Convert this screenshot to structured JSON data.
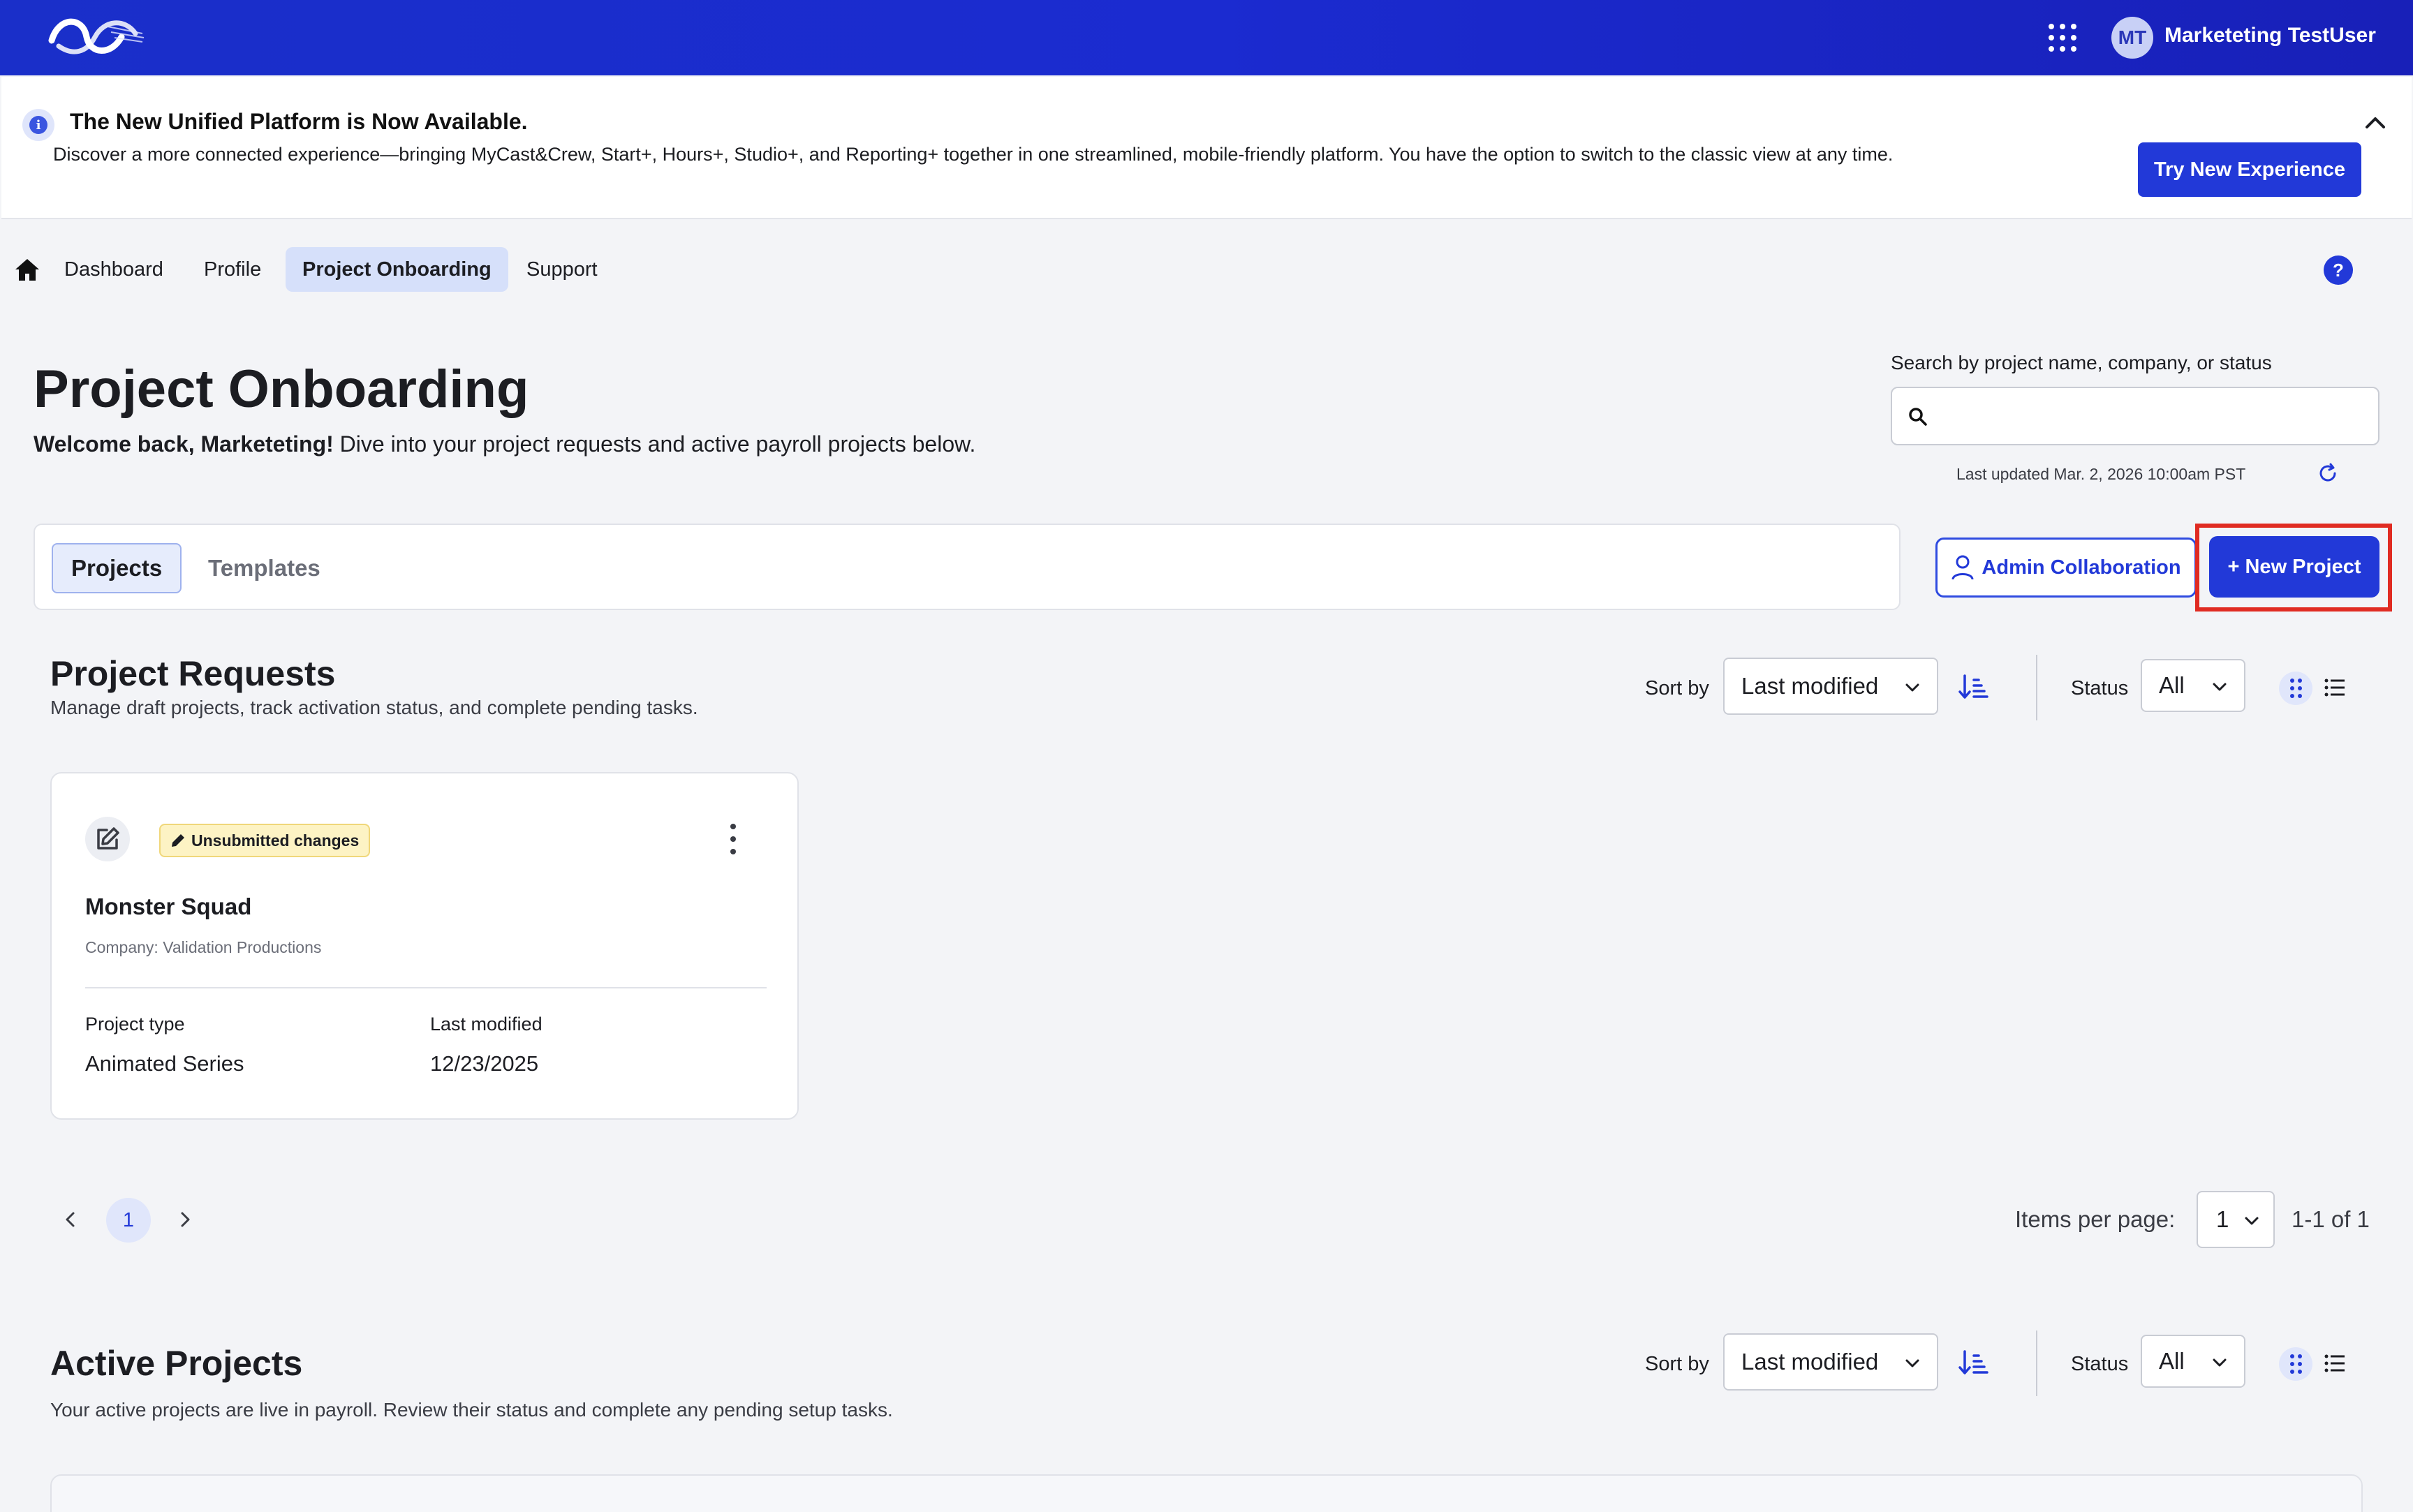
{
  "colors": {
    "brand": "#1b2bd0",
    "primary_button": "#2239d8",
    "active_nav_bg": "#d6e0fa",
    "badge_bg": "#fdf3c4",
    "highlight_border": "#e02b22"
  },
  "header": {
    "user_initials": "MT",
    "user_name": "Marketeting TestUser",
    "logo_icon": "wave-logo-icon",
    "apps_icon": "apps-grid-icon"
  },
  "banner": {
    "title": "The New Unified Platform is Now Available.",
    "text": "Discover a more connected experience—bringing MyCast&Crew, Start+, Hours+, Studio+, and Reporting+ together in one streamlined, mobile-friendly platform. You have the option to switch to the classic view at any time.",
    "button_label": "Try New Experience"
  },
  "nav": {
    "items": [
      {
        "label": "Dashboard"
      },
      {
        "label": "Profile"
      },
      {
        "label": "Project Onboarding"
      },
      {
        "label": "Support"
      }
    ],
    "active": "Project Onboarding",
    "help_label": "?"
  },
  "page": {
    "title": "Project Onboarding",
    "welcome_bold": "Welcome back, Marketeting!",
    "welcome_text": " Dive into your project requests and active payroll projects below."
  },
  "search": {
    "label": "Search by project name, company, or status",
    "value": "",
    "placeholder": "",
    "last_updated": "Last updated Mar. 2, 2026 10:00am PST"
  },
  "tabs": [
    {
      "label": "Projects"
    },
    {
      "label": "Templates"
    }
  ],
  "actions": {
    "admin_collab_label": "Admin Collaboration",
    "new_project_label": "+ New Project"
  },
  "project_requests": {
    "title": "Project Requests",
    "description": "Manage draft projects, track activation status, and complete pending tasks.",
    "sort_label": "Sort by",
    "sort_value": "Last modified",
    "status_label": "Status",
    "status_value": "All",
    "cards": [
      {
        "badge": "Unsubmitted changes",
        "title": "Monster Squad",
        "company": "Company: Validation Productions",
        "type_label": "Project type",
        "type_value": "Animated Series",
        "modified_label": "Last modified",
        "modified_value": "12/23/2025"
      }
    ],
    "pagination": {
      "current_page": "1",
      "items_per_page_label": "Items per page:",
      "items_per_page": "1",
      "range": "1-1 of 1"
    }
  },
  "active_projects": {
    "title": "Active Projects",
    "description": "Your active projects are live in payroll. Review their status and complete any pending setup tasks.",
    "sort_label": "Sort by",
    "sort_value": "Last modified",
    "status_label": "Status",
    "status_value": "All"
  }
}
